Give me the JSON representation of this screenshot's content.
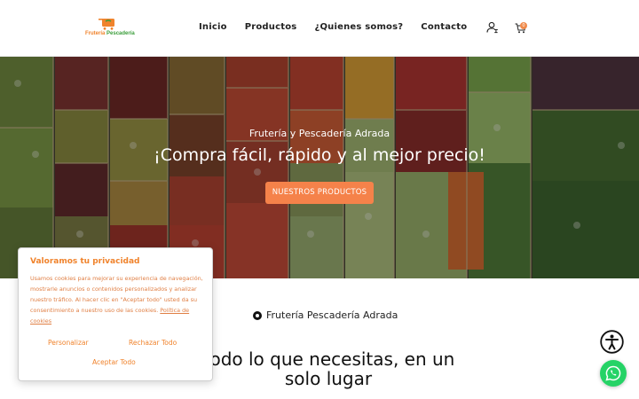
{
  "header": {
    "logo": {
      "word1": "Frutería",
      "word2": "Pescadería"
    },
    "nav": [
      {
        "label": "Inicio"
      },
      {
        "label": "Productos"
      },
      {
        "label": "¿Quienes somos?"
      },
      {
        "label": "Contacto"
      }
    ],
    "user_icon": "user-icon",
    "cart_icon": "cart-icon",
    "cart_count": "0"
  },
  "hero": {
    "subtitle": "Frutería y Pescadería Adrada",
    "title": "¡Compra fácil, rápido y al mejor precio!",
    "button_label": "NUESTROS PRODUCTOS"
  },
  "section": {
    "tag": "Frutería Pescadería Adrada",
    "headline": "Todo lo que necesitas, en un solo lugar"
  },
  "cookie_banner": {
    "title": "Valoramos tu privacidad",
    "text": "Usamos cookies para mejorar su experiencia de navegación, mostrarle anuncios o contenidos personalizados y analizar nuestro tráfico. Al hacer clic en \"Aceptar todo\" usted da su consentimiento a nuestro uso de las cookies.",
    "policy_link": "Política de cookies",
    "personalize_label": "Personalizar",
    "reject_label": "Rechazar Todo",
    "accept_label": "Aceptar Todo"
  },
  "floating": {
    "accessibility_icon": "accessibility-icon",
    "whatsapp_icon": "whatsapp-icon"
  },
  "colors": {
    "accent": "#f5824a",
    "brand_orange": "#f0832c",
    "brand_green": "#3a9d3a",
    "whatsapp": "#25d366"
  }
}
